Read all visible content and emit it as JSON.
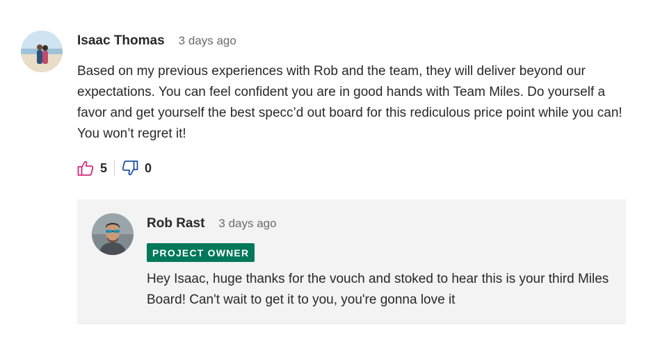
{
  "comment": {
    "author": "Isaac Thomas",
    "time": "3 days ago",
    "text": "Based on my previous experiences with Rob and the team, they will deliver beyond our expectations. You can feel confident you are in good hands with Team Miles. Do yourself a favor and get yourself the best specc’d out board for this rediculous price point while you can! You won’t regret it!",
    "upvotes": "5",
    "downvotes": "0"
  },
  "reply": {
    "author": "Rob Rast",
    "time": "3 days ago",
    "badge": "PROJECT OWNER",
    "text": "Hey Isaac, huge thanks for the vouch and stoked to hear this is your third Miles Board! Can't wait to get it to you, you're gonna love it"
  },
  "colors": {
    "upvote_icon": "#d6287c",
    "downvote_icon": "#1e4fa0",
    "badge_bg": "#00785a",
    "reply_bg": "#f3f3f3"
  },
  "icons": {
    "upvote": "thumbs-up-icon",
    "downvote": "thumbs-down-icon"
  }
}
